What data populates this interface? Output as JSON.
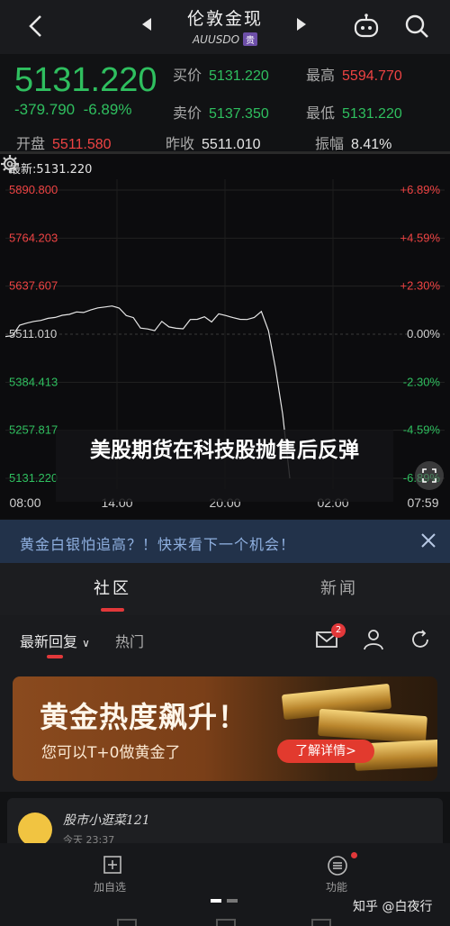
{
  "nav": {
    "title": "伦敦金现",
    "symbol": "AUUSDO",
    "tag": "贵"
  },
  "quote": {
    "price": "5131.220",
    "change": "-379.790",
    "change_pct": "-6.89%",
    "buy_label": "买价",
    "buy": "5131.220",
    "sell_label": "卖价",
    "sell": "5137.350",
    "high_label": "最高",
    "high": "5594.770",
    "low_label": "最低",
    "low": "5131.220",
    "open_label": "开盘",
    "open": "5511.580",
    "prev_label": "昨收",
    "prev": "5511.010",
    "amp_label": "振幅",
    "amp": "8.41%"
  },
  "chart": {
    "latest_label": "最新:5131.220",
    "y_left": [
      "5890.800",
      "5764.203",
      "5637.607",
      "5511.010",
      "5384.413",
      "5257.817",
      "5131.220"
    ],
    "y_right": [
      "+6.89%",
      "+4.59%",
      "+2.30%",
      "0.00%",
      "-2.30%",
      "-4.59%",
      "-6.89%"
    ],
    "x_labels": [
      "08:00",
      "14:00",
      "20:00",
      "02:00",
      "07:59"
    ],
    "news_banner": "美股期货在科技股抛售后反弹",
    "colors": {
      "up": "#ee4343",
      "down": "#2fbf5f",
      "line": "#e6e6e6"
    }
  },
  "chart_data": {
    "type": "line",
    "x_range": [
      "08:00",
      "07:59"
    ],
    "ylim": [
      5131.22,
      5890.8
    ],
    "prev_close": 5511.01,
    "series": [
      {
        "values": [
          5500,
          5512,
          5530,
          5545,
          5540,
          5552,
          5548,
          5560,
          5556,
          5568,
          5565,
          5573,
          5570,
          5585,
          5578,
          5590,
          5575,
          5565,
          5550,
          5532,
          5520,
          5525,
          5540,
          5535,
          5522,
          5530,
          5545,
          5555,
          5552,
          5548,
          5560,
          5565,
          5550,
          5555,
          5545,
          5560,
          5566,
          5520,
          5420,
          5300,
          5131
        ]
      }
    ]
  },
  "notice": {
    "text": "黄金白银怕追高？！快来看下一个机会！"
  },
  "tabs": {
    "community": "社区",
    "news": "新闻"
  },
  "filters": {
    "latest_reply": "最新回复",
    "hot": "热门",
    "mail_badge": "2"
  },
  "ad": {
    "headline": "黄金热度飙升！",
    "sub": "您可以T+0做黄金了",
    "cta": "了解详情>"
  },
  "post": {
    "username": "股市小逛菜121",
    "meta": "今天 23:37"
  },
  "bottom": {
    "add_fav": "加自选",
    "functions": "功能",
    "watermark": "知乎 @白夜行"
  }
}
